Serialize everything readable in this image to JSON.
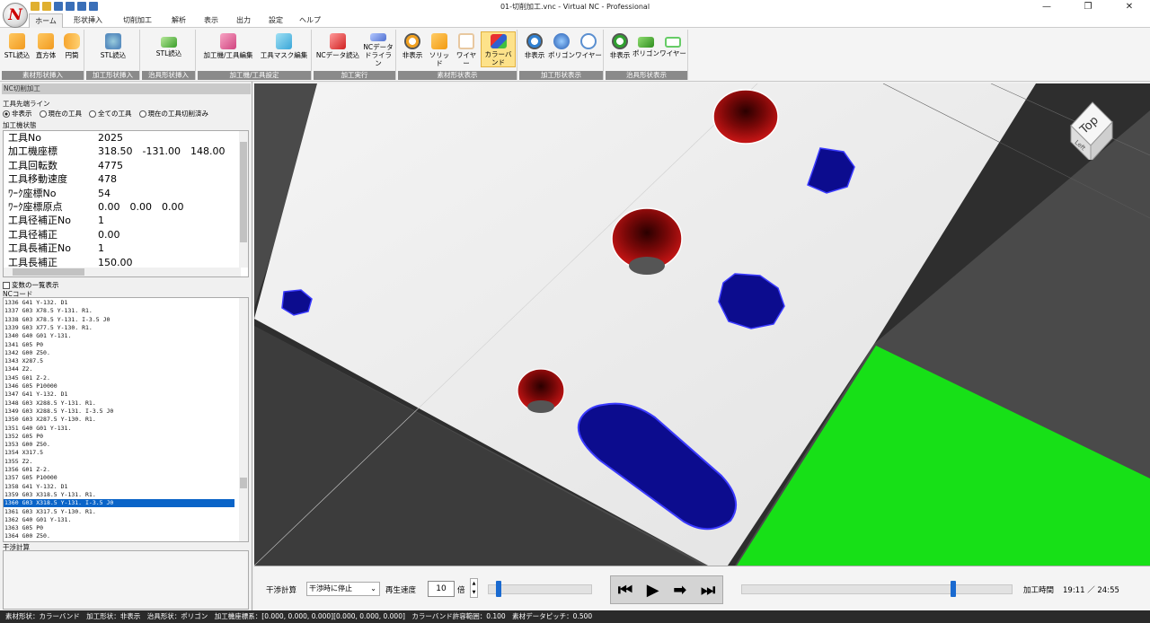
{
  "window": {
    "title": "01-切削加工.vnc - Virtual NC - Professional",
    "minimize": "—",
    "maximize": "❐",
    "close": "✕"
  },
  "logo": {
    "letter": "N"
  },
  "menu": {
    "tabs": [
      "ホーム",
      "形状挿入",
      "切削加工",
      "解析",
      "表示",
      "出力",
      "設定",
      "ヘルプ"
    ],
    "active": 0
  },
  "ribbon": {
    "stock": {
      "label": "素材形状挿入",
      "buttons": [
        "STL読込",
        "直方体",
        "円筒"
      ]
    },
    "machined": {
      "label": "加工形状挿入",
      "buttons": [
        "STL読込"
      ]
    },
    "jig": {
      "label": "治具形状挿入",
      "buttons": [
        "STL読込"
      ]
    },
    "machine": {
      "label": "加工機/工具設定",
      "buttons": [
        "加工機/工具編集",
        "工具マスク編集"
      ]
    },
    "exec": {
      "label": "加工実行",
      "buttons": [
        "NCデータ読込",
        "NCデータ\nドライラン"
      ]
    },
    "stockview": {
      "label": "素材形状表示",
      "buttons": [
        "非表示",
        "ソリッド",
        "ワイヤー",
        "カラーバンド"
      ],
      "selected": 3
    },
    "machview": {
      "label": "加工形状表示",
      "buttons": [
        "非表示",
        "ポリゴン",
        "ワイヤー"
      ]
    },
    "jigview": {
      "label": "治具形状表示",
      "buttons": [
        "非表示",
        "ポリゴン",
        "ワイヤー"
      ]
    }
  },
  "left": {
    "header": "NC切削加工",
    "tooltip_label": "工具先端ライン",
    "radios": [
      "非表示",
      "現在の工具",
      "全ての工具",
      "現在の工具切削済み"
    ],
    "radio_selected": 0,
    "state_label": "加工機状態",
    "state": [
      [
        "工具No",
        "2025"
      ],
      [
        "加工機座標",
        "318.50　-131.00　148.00"
      ],
      [
        "工具回転数",
        "4775"
      ],
      [
        "工具移動速度",
        "478"
      ],
      [
        "ﾜｰｸ座標No",
        "54"
      ],
      [
        "ﾜｰｸ座標原点",
        "0.00　0.00　0.00"
      ],
      [
        "工具径補正No",
        "1"
      ],
      [
        "工具径補正",
        "0.00"
      ],
      [
        "工具長補正No",
        "1"
      ],
      [
        "工具長補正",
        "150.00"
      ]
    ],
    "var_check": "変数の一覧表示",
    "nc_label": "NCコード",
    "nc_lines": [
      "1336  G41 Y-132. D1",
      "1337  G03 X78.5 Y-131. R1.",
      "1338  G03 X78.5 Y-131. I-3.5 J0",
      "1339  G03 X77.5 Y-130. R1.",
      "1340  G40 G01 Y-131.",
      "1341  G05 P0",
      "1342  G00 Z50.",
      "1343  X287.5",
      "1344  Z2.",
      "1345  G01 Z-2.",
      "1346  G05 P10000",
      "1347  G41 Y-132. D1",
      "1348  G03 X288.5 Y-131. R1.",
      "1349  G03 X288.5 Y-131. I-3.5 J0",
      "1350  G03 X287.5 Y-130. R1.",
      "1351  G40 G01 Y-131.",
      "1352  G05 P0",
      "1353  G00 Z50.",
      "1354  X317.5",
      "1355  Z2.",
      "1356  G01 Z-2.",
      "1357  G05 P10000",
      "1358  G41 Y-132. D1",
      "1359  G03 X318.5 Y-131. R1.",
      "1360  G03 X318.5 Y-131. I-3.5 J0",
      "1361  G03 X317.5 Y-130. R1.",
      "1362  G40 G01 Y-131.",
      "1363  G05 P0",
      "1364  G00 Z50."
    ],
    "nc_selected": 24,
    "interference_label": "干渉計算"
  },
  "viewport": {
    "cube_top": "Top",
    "cube_left": "Left"
  },
  "bottom": {
    "interference": "干渉計算",
    "mode": "干渉時に停止",
    "speed_label": "再生速度",
    "speed": "10",
    "speed_unit": "倍",
    "time_label": "加工時間",
    "time": "19:11 ／ 24:55",
    "progress": 0.78,
    "speed_slider": 0.1
  },
  "status": "素材形状：カラーバンド　加工形状：非表示　治具形状：ポリゴン　加工機座標系：[0.000, 0.000, 0.000][0.000, 0.000, 0.000]　カラーバンド許容範囲：0.100　素材データピッチ：0.500"
}
